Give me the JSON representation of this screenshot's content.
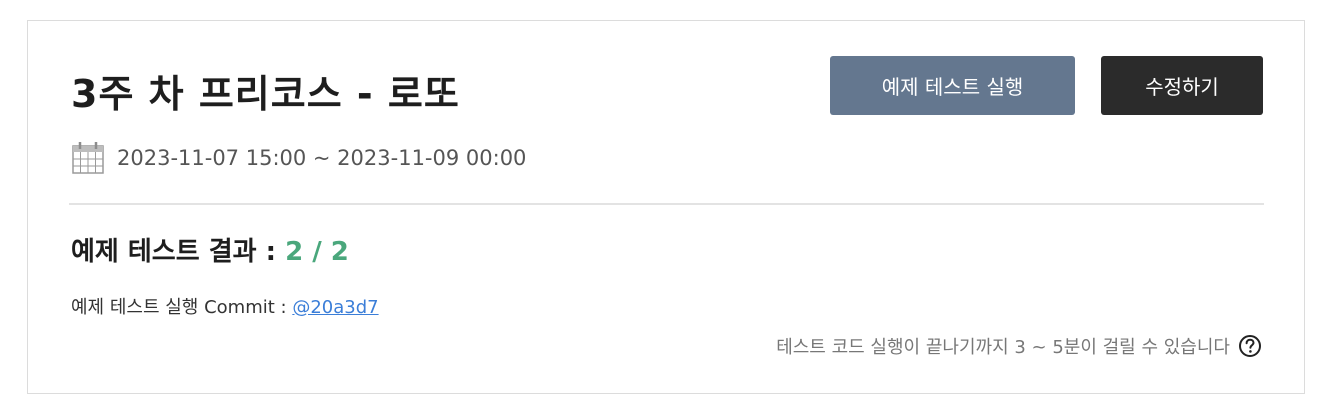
{
  "header": {
    "title": "3주 차 프리코스 - 로또",
    "run_test_label": "예제 테스트 실행",
    "edit_label": "수정하기"
  },
  "period": {
    "icon": "calendar-icon",
    "text": "2023-11-07 15:00 ~ 2023-11-09 00:00"
  },
  "result": {
    "label": "예제 테스트 결과 :",
    "score": "2 / 2",
    "score_color": "#4aa77c",
    "commit_label": "예제 테스트 실행 Commit :",
    "commit_link": "@20a3d7"
  },
  "notice": {
    "text": "테스트 코드 실행이 끝나기까지 3 ~ 5분이 걸릴 수 있습니다",
    "icon": "help-icon"
  },
  "colors": {
    "run_button": "#64778f",
    "edit_button": "#2b2b2b",
    "link": "#3b7ed8"
  }
}
